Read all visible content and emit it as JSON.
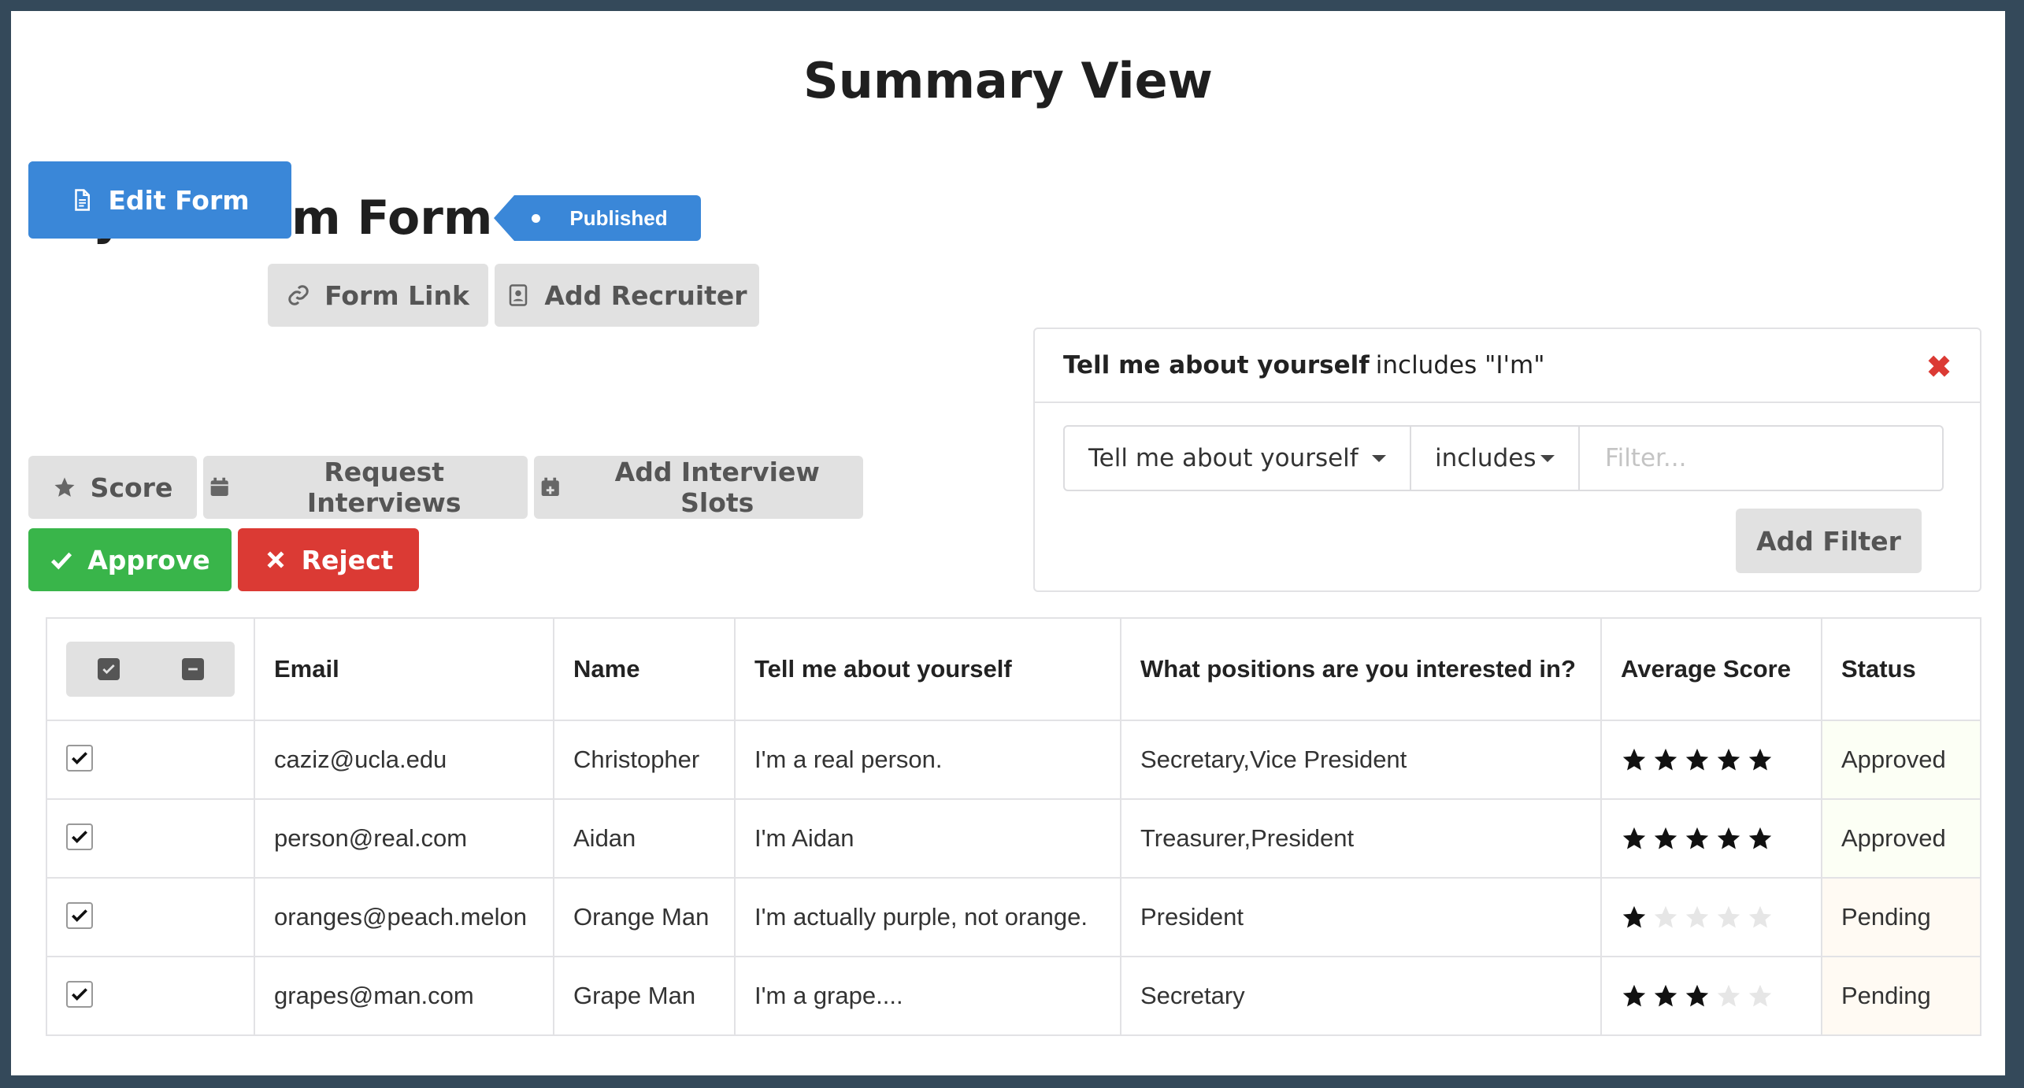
{
  "page": {
    "title": "Summary View"
  },
  "form": {
    "title": "My Custom Form",
    "status_tag": "Published"
  },
  "toolbar_top": {
    "edit_form": "Edit Form",
    "form_link": "Form Link",
    "add_recruiter": "Add Recruiter"
  },
  "toolbar_actions": {
    "score": "Score",
    "request_interviews": "Request Interviews",
    "add_interview_slots": "Add Interview Slots",
    "approve": "Approve",
    "reject": "Reject"
  },
  "filter": {
    "summary_field": "Tell me about yourself",
    "summary_rest": "includes \"I'm\"",
    "field_select": "Tell me about yourself",
    "operator_select": "includes",
    "value_placeholder": "Filter...",
    "add_button": "Add Filter"
  },
  "table": {
    "columns": [
      "Email",
      "Name",
      "Tell me about yourself",
      "What positions are you interested in?",
      "Average Score",
      "Status"
    ],
    "rows": [
      {
        "checked": true,
        "email": "caziz@ucla.edu",
        "name": "Christopher",
        "about": "I'm a real person.",
        "positions": "Secretary,Vice President",
        "score": 5,
        "status": "Approved"
      },
      {
        "checked": true,
        "email": "person@real.com",
        "name": "Aidan",
        "about": "I'm Aidan",
        "positions": "Treasurer,President",
        "score": 5,
        "status": "Approved"
      },
      {
        "checked": true,
        "email": "oranges@peach.melon",
        "name": "Orange Man",
        "about": "I'm actually purple, not orange.",
        "positions": "President",
        "score": 1,
        "status": "Pending"
      },
      {
        "checked": true,
        "email": "grapes@man.com",
        "name": "Grape Man",
        "about": "I'm a grape....",
        "positions": "Secretary",
        "score": 3,
        "status": "Pending"
      }
    ]
  },
  "colors": {
    "primary": "#3a87d8",
    "approve": "#39b54a",
    "reject": "#db3a34",
    "approved_text": "#2c662d",
    "pending_text": "#573a08"
  }
}
